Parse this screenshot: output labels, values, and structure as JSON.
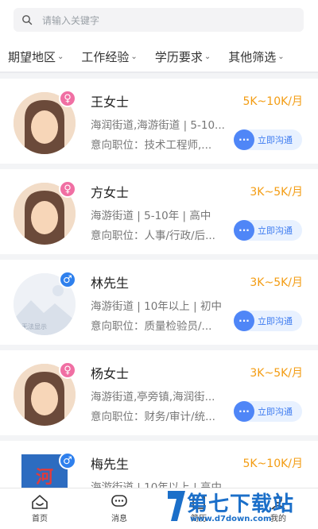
{
  "search": {
    "placeholder": "请输入关键字"
  },
  "filters": [
    {
      "label": "期望地区"
    },
    {
      "label": "工作经验"
    },
    {
      "label": "学历要求"
    },
    {
      "label": "其他筛选"
    }
  ],
  "candidates": [
    {
      "name": "王女士",
      "salary": "5K~10K/月",
      "info": "海润街道,海游街道 | 5-10...",
      "intent": "意向职位：技术工程师,...",
      "gender": "female",
      "chat": "立即沟通"
    },
    {
      "name": "方女士",
      "salary": "3K~5K/月",
      "info": "海游街道 | 5-10年 | 高中",
      "intent": "意向职位：人事/行政/后...",
      "gender": "female",
      "chat": "立即沟通"
    },
    {
      "name": "林先生",
      "salary": "3K~5K/月",
      "info": "海游街道 | 10年以上 | 初中",
      "intent": "意向职位：质量检验员/...",
      "gender": "male",
      "chat": "立即沟通",
      "avatar_text": "无法显示"
    },
    {
      "name": "杨女士",
      "salary": "3K~5K/月",
      "info": "海游街道,亭旁镇,海润街...",
      "intent": "意向职位：财务/审计/统...",
      "gender": "female",
      "chat": "立即沟通"
    },
    {
      "name": "梅先生",
      "salary": "5K~10K/月",
      "info": "海游街道 | 10年以上 | 高中",
      "gender": "male"
    }
  ],
  "tabs": [
    {
      "label": "首页",
      "icon": "home-icon"
    },
    {
      "label": "消息",
      "icon": "message-icon"
    },
    {
      "label": "简历",
      "icon": "resume-icon"
    },
    {
      "label": "我的",
      "icon": "profile-icon"
    }
  ],
  "watermark": {
    "main": "第七下载站",
    "url": "www.d7down.com"
  },
  "colors": {
    "salary": "#f39c12",
    "female": "#f06fa3",
    "male": "#2f80ed",
    "chat": "#3d7bf0"
  }
}
